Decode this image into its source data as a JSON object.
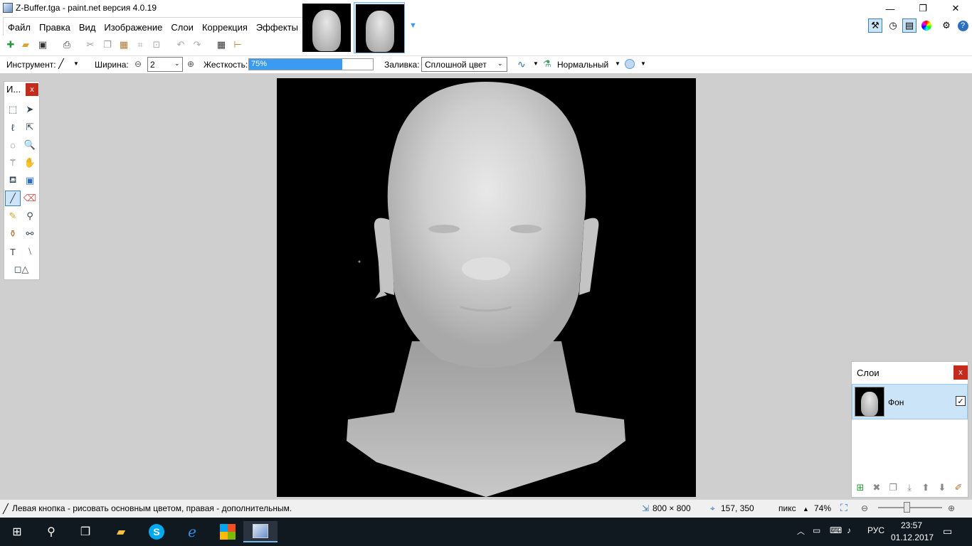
{
  "window": {
    "title": "Z-Buffer.tga - paint.net версия 4.0.19",
    "minimize_glyph": "—",
    "restore_glyph": "❐",
    "close_glyph": "✕"
  },
  "menu": {
    "items": [
      "Файл",
      "Правка",
      "Вид",
      "Изображение",
      "Слои",
      "Коррекция",
      "Эффекты"
    ]
  },
  "toolbar": {
    "tool_label": "Инструмент:",
    "width_label": "Ширина:",
    "width_value": "2",
    "hardness_label": "Жесткость:",
    "hardness_value": "75%",
    "hardness_fraction": 0.75,
    "fill_label": "Заливка:",
    "fill_value": "Сплошной цвет",
    "blend_mode": "Нормальный"
  },
  "tools_panel": {
    "title": "И...",
    "close": "x"
  },
  "layers_panel": {
    "title": "Слои",
    "close": "x",
    "layer_name": "Фон",
    "layer_visible_check": "✓"
  },
  "status": {
    "hint": "Левая кнопка - рисовать основным цветом, правая - дополнительным.",
    "image_size": "800 × 800",
    "cursor_pos": "157, 350",
    "units": "пикс",
    "zoom": "74%"
  },
  "taskbar": {
    "language": "РУС",
    "time": "23:57",
    "date": "01.12.2017"
  },
  "colors": {
    "accent": "#3b9bf2",
    "close_red": "#c42b1c",
    "taskbar": "#101820"
  }
}
